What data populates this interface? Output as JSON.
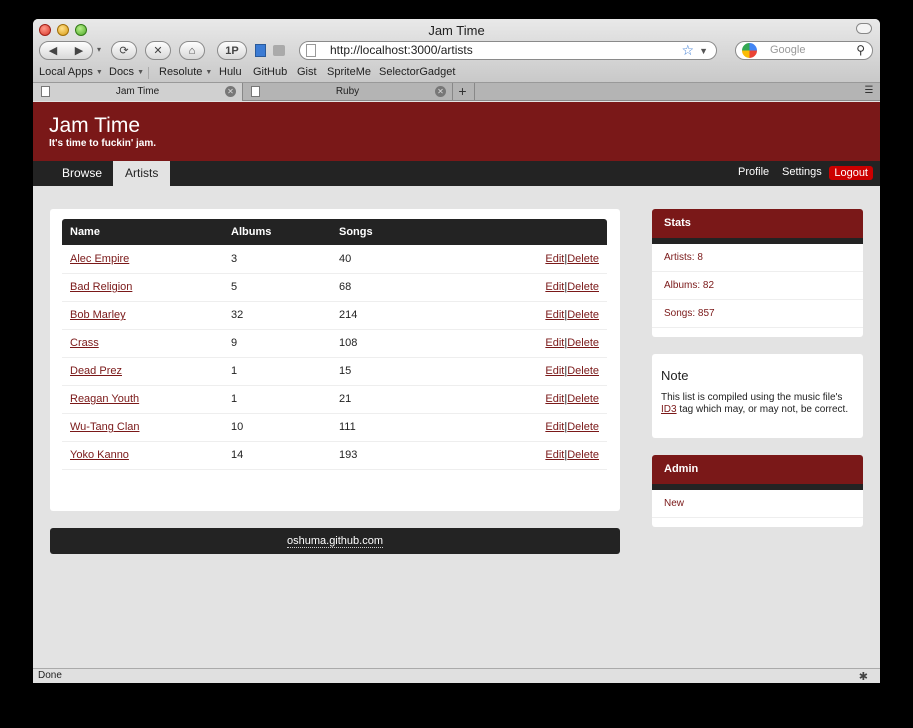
{
  "window": {
    "title": "Jam Time"
  },
  "toolbar": {
    "back": "◀",
    "forward": "▶",
    "dropdown": "▾",
    "reload": "⟳",
    "stop": "✕",
    "home": "⌂",
    "onepassword": "1P",
    "url": "http://localhost:3000/artists",
    "search_placeholder": "Google"
  },
  "bookmarks": [
    "Local Apps",
    "Docs",
    "Resolute",
    "Hulu",
    "GitHub",
    "Gist",
    "SpriteMe",
    "SelectorGadget"
  ],
  "tabs": [
    {
      "label": "Jam Time",
      "active": true
    },
    {
      "label": "Ruby",
      "active": false
    }
  ],
  "site": {
    "title": "Jam Time",
    "tagline": "It's time to fuckin' jam."
  },
  "nav": {
    "browse": "Browse",
    "artists": "Artists",
    "profile": "Profile",
    "settings": "Settings",
    "logout": "Logout"
  },
  "table": {
    "headers": [
      "Name",
      "Albums",
      "Songs",
      ""
    ],
    "edit_label": "Edit",
    "delete_label": "Delete",
    "separator": "|",
    "rows": [
      {
        "name": "Alec Empire",
        "albums": "3",
        "songs": "40"
      },
      {
        "name": "Bad Religion",
        "albums": "5",
        "songs": "68"
      },
      {
        "name": "Bob Marley",
        "albums": "32",
        "songs": "214"
      },
      {
        "name": "Crass",
        "albums": "9",
        "songs": "108"
      },
      {
        "name": "Dead Prez",
        "albums": "1",
        "songs": "15"
      },
      {
        "name": "Reagan Youth",
        "albums": "1",
        "songs": "21"
      },
      {
        "name": "Wu-Tang Clan",
        "albums": "10",
        "songs": "111"
      },
      {
        "name": "Yoko Kanno",
        "albums": "14",
        "songs": "193"
      }
    ]
  },
  "footer": {
    "link": "oshuma.github.com"
  },
  "stats": {
    "title": "Stats",
    "items": [
      "Artists: 8",
      "Albums: 82",
      "Songs: 857"
    ]
  },
  "note": {
    "title": "Note",
    "text_before": "This list is compiled using the music file's ",
    "link": "ID3",
    "text_after": " tag which may, or may not, be correct."
  },
  "admin": {
    "title": "Admin",
    "items": [
      "New"
    ]
  },
  "statusbar": {
    "text": "Done"
  },
  "colors": {
    "brand": "#7a1818",
    "dark": "#232323",
    "logout": "#cc0000"
  }
}
